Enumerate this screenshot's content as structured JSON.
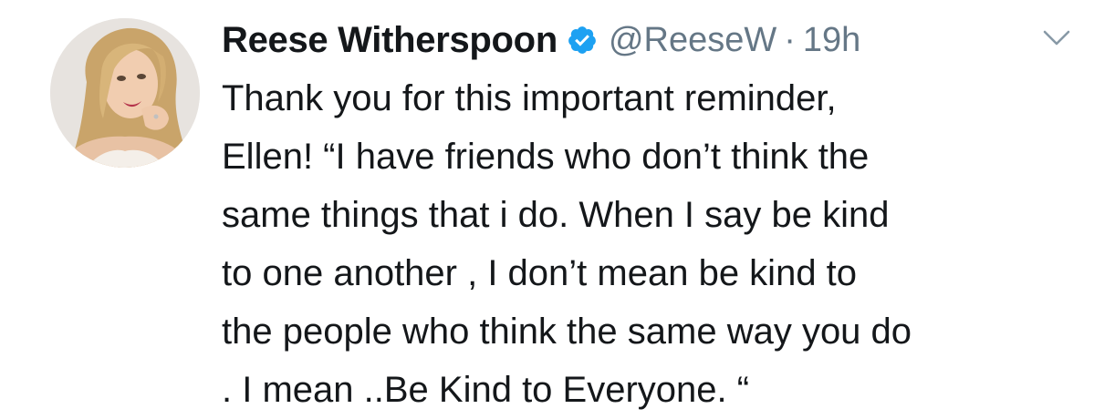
{
  "author": {
    "display_name": "Reese Witherspoon",
    "handle": "@ReeseW",
    "separator": "·",
    "timestamp": "19h",
    "verified": true,
    "verified_color": "#1da1f2"
  },
  "tweet": {
    "lines": [
      "Thank you for this important reminder,",
      "Ellen! “I have friends who don’t think the",
      "same things that i do. When I say be kind",
      "to one another , I don’t mean be kind to",
      "the people who think the same way you do",
      ". I mean ..Be Kind to Everyone. “"
    ]
  },
  "icons": {
    "verified": "verified-badge-icon",
    "menu": "chevron-down-icon",
    "avatar": "profile-avatar"
  }
}
